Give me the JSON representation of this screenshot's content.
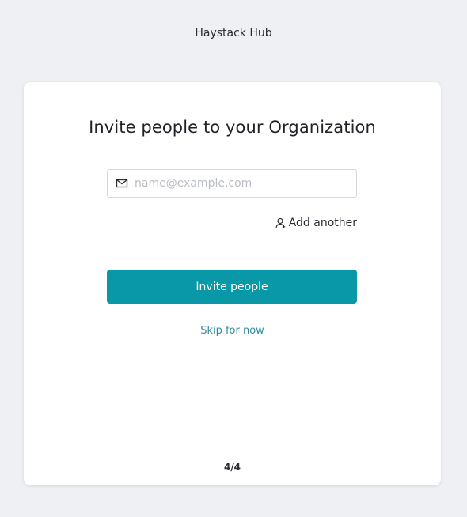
{
  "app": {
    "title": "Haystack Hub"
  },
  "invite": {
    "heading": "Invite people to your Organization",
    "email_placeholder": "name@example.com",
    "email_value": "",
    "add_another_label": "Add another",
    "submit_label": "Invite people",
    "skip_label": "Skip for now",
    "step": "4/4"
  },
  "colors": {
    "accent": "#0898a8",
    "link": "#2f8fa0",
    "background": "#eef0f4"
  },
  "icons": {
    "email": "mail-icon",
    "add_another": "user-icon"
  }
}
